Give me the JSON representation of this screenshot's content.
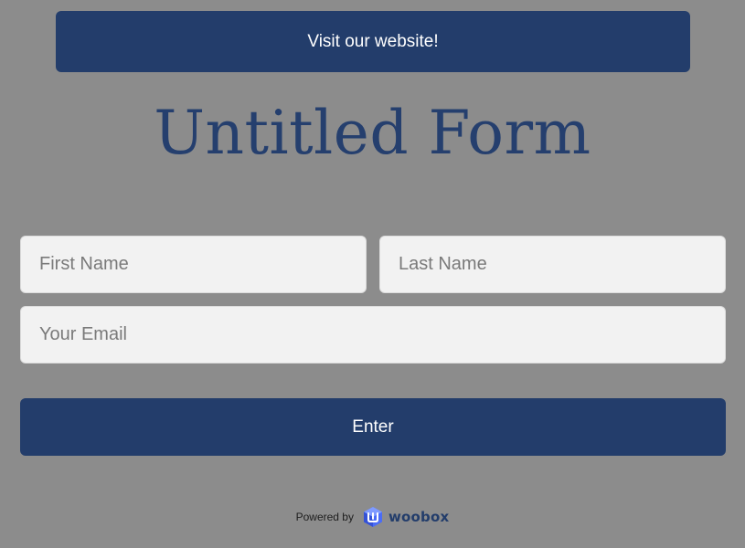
{
  "header": {
    "visit_label": "Visit our website!"
  },
  "form": {
    "title": "Untitled Form",
    "first_name": {
      "placeholder": "First Name",
      "value": ""
    },
    "last_name": {
      "placeholder": "Last Name",
      "value": ""
    },
    "email": {
      "placeholder": "Your Email",
      "value": ""
    },
    "submit_label": "Enter"
  },
  "footer": {
    "powered_by": "Powered by",
    "brand": "woobox",
    "brand_icon": "woobox-logo-icon"
  },
  "colors": {
    "background": "#8c8c8c",
    "accent": "#233d6b",
    "title": "#253f6e",
    "field_bg": "#f2f2f2"
  }
}
